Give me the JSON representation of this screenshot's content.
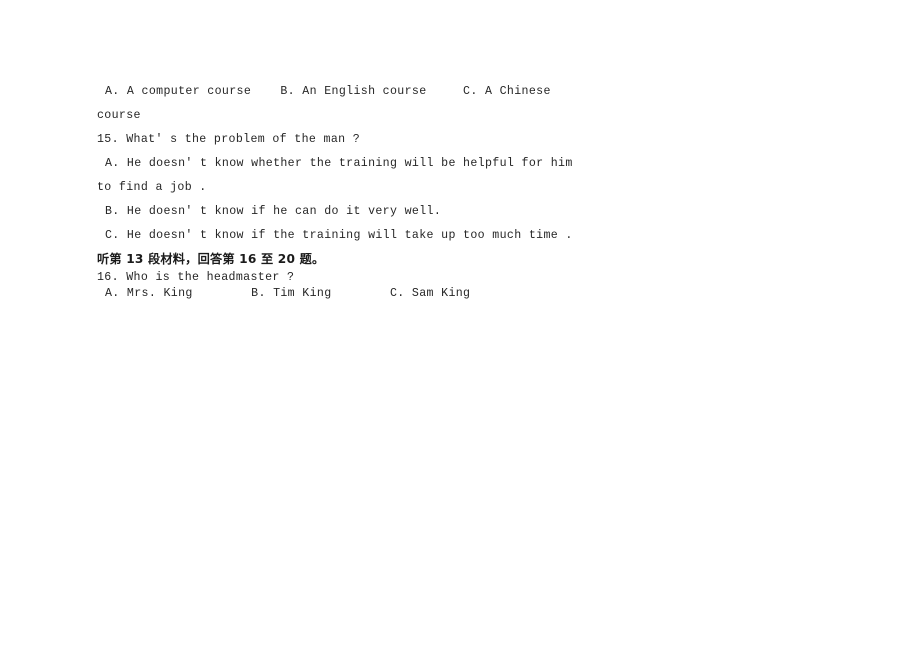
{
  "document": {
    "type": "listening-comprehension-worksheet",
    "page_background": "#ffffff",
    "text_color": "#262626"
  },
  "content": {
    "q14_options_line": "A. A computer course    B. An English course     C. A Chinese",
    "q14_options_wrap": "course",
    "q15_stem": "15. What' s the problem of the man ?",
    "q15_option_a": "A. He doesn' t know whether the training will be helpful for him",
    "q15_option_a_wrap": "to find a job .",
    "q15_option_b": "B. He doesn' t know if he can do it very well.",
    "q15_option_c": "C. He doesn' t know if the training will take up too much time .",
    "section_direction": "听第 13 段材料，回答第 16 至 20 题。",
    "q16_stem": "16. Who is the headmaster ?",
    "q16_options_line": "A. Mrs. King        B. Tim King        C. Sam King"
  }
}
